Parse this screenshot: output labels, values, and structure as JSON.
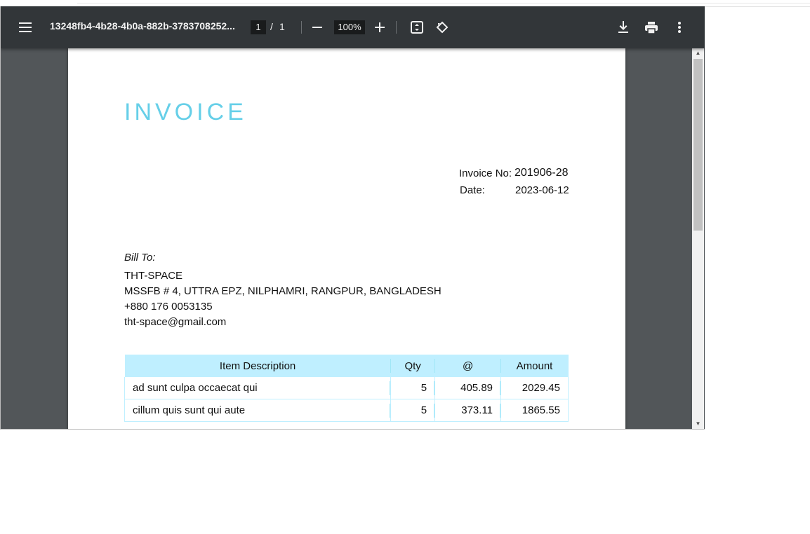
{
  "toolbar": {
    "filename": "13248fb4-4b28-4b0a-882b-3783708252...",
    "page_current": "1",
    "page_separator": "/",
    "page_total": "1",
    "zoom": "100%"
  },
  "invoice": {
    "heading": "INVOICE",
    "number_label": "Invoice No:",
    "number_value": "201906-28",
    "date_label": "Date:",
    "date_value": "2023-06-12"
  },
  "bill_to": {
    "label": "Bill To:",
    "lines": [
      "THT-SPACE",
      "MSSFB # 4, UTTRA EPZ, NILPHAMRI, RANGPUR, BANGLADESH",
      "+880 176 0053135",
      "tht-space@gmail.com"
    ]
  },
  "table": {
    "headers": [
      "Item Description",
      "Qty",
      "@",
      "Amount"
    ],
    "rows": [
      [
        "ad sunt culpa occaecat qui",
        "5",
        "405.89",
        "2029.45"
      ],
      [
        "cillum quis sunt qui aute",
        "5",
        "373.11",
        "1865.55"
      ]
    ]
  },
  "colors": {
    "toolbar_bg": "#323639",
    "viewer_bg": "#525659",
    "accent": "#66cfe8",
    "table_header_bg": "#bfefff"
  },
  "icons": {
    "menu": "menu-icon",
    "zoom_out": "minus-icon",
    "zoom_in": "plus-icon",
    "fit": "fit-page-icon",
    "rotate": "rotate-icon",
    "download": "download-icon",
    "print": "print-icon",
    "more": "more-vert-icon"
  }
}
